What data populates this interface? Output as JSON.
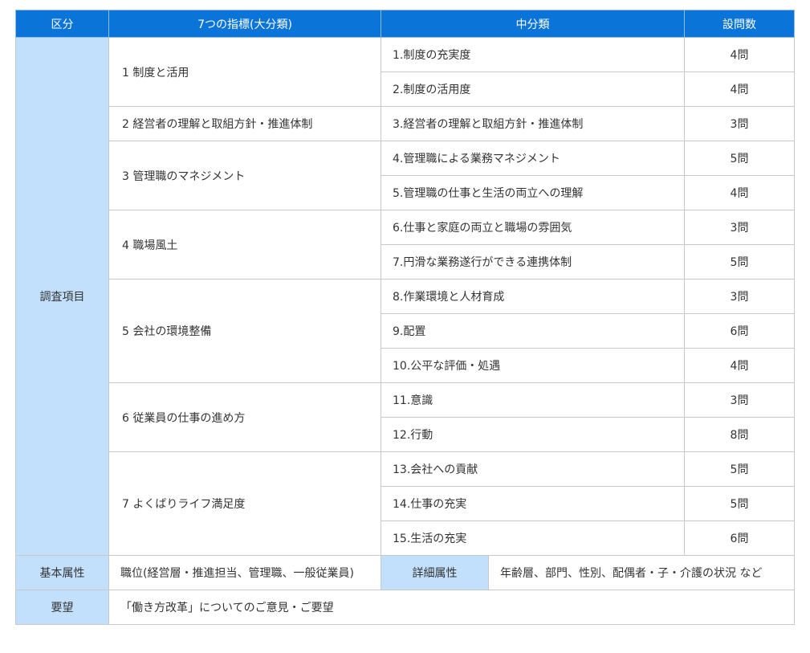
{
  "header": {
    "col1": "区分",
    "col2": "7つの指標(大分類)",
    "col3": "中分類",
    "col4": "設問数"
  },
  "survey_category": "調査項目",
  "indicators": [
    {
      "label": "1 制度と活用",
      "items": [
        {
          "name": "1.制度の充実度",
          "count": "4問"
        },
        {
          "name": "2.制度の活用度",
          "count": "4問"
        }
      ]
    },
    {
      "label": "2 経営者の理解と取組方針・推進体制",
      "items": [
        {
          "name": "3.経営者の理解と取組方針・推進体制",
          "count": "3問"
        }
      ]
    },
    {
      "label": "3 管理職のマネジメント",
      "items": [
        {
          "name": "4.管理職による業務マネジメント",
          "count": "5問"
        },
        {
          "name": "5.管理職の仕事と生活の両立への理解",
          "count": "4問"
        }
      ]
    },
    {
      "label": "4 職場風土",
      "items": [
        {
          "name": "6.仕事と家庭の両立と職場の雰囲気",
          "count": "3問"
        },
        {
          "name": "7.円滑な業務遂行ができる連携体制",
          "count": "5問"
        }
      ]
    },
    {
      "label": "5 会社の環境整備",
      "items": [
        {
          "name": "8.作業環境と人材育成",
          "count": "3問"
        },
        {
          "name": "9.配置",
          "count": "6問"
        },
        {
          "name": "10.公平な評価・処遇",
          "count": "4問"
        }
      ]
    },
    {
      "label": "6 従業員の仕事の進め方",
      "items": [
        {
          "name": "11.意識",
          "count": "3問"
        },
        {
          "name": "12.行動",
          "count": "8問"
        }
      ]
    },
    {
      "label": "7 よくばりライフ満足度",
      "items": [
        {
          "name": "13.会社への貢献",
          "count": "5問"
        },
        {
          "name": "14.仕事の充実",
          "count": "5問"
        },
        {
          "name": "15.生活の充実",
          "count": "6問"
        }
      ]
    }
  ],
  "basic": {
    "label": "基本属性",
    "value": "職位(経営層・推進担当、管理職、一般従業員)",
    "detail_label": "詳細属性",
    "detail_value": "年齢層、部門、性別、配偶者・子・介護の状況 など"
  },
  "request": {
    "label": "要望",
    "value": "「働き方改革」についてのご意見・ご要望"
  }
}
